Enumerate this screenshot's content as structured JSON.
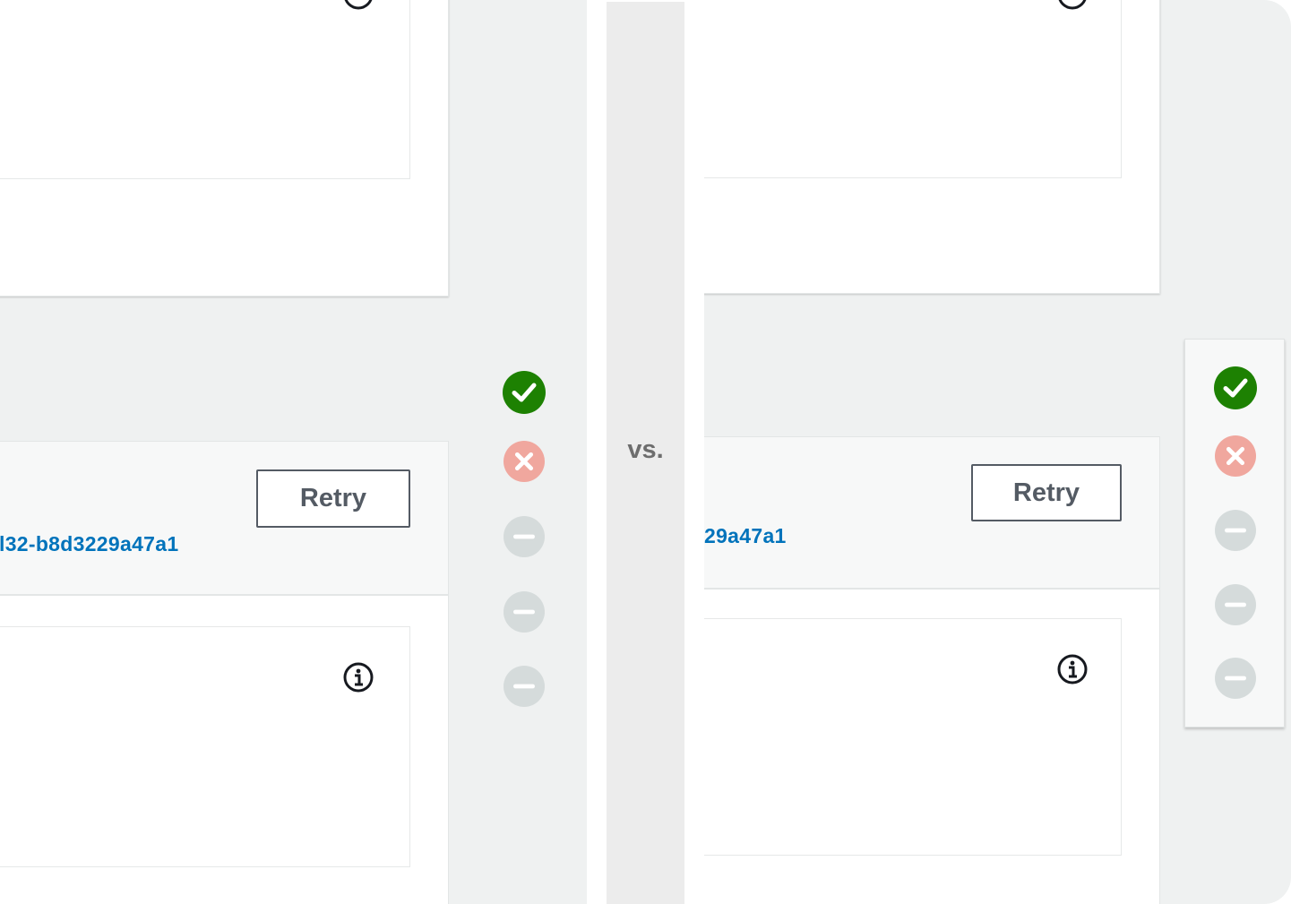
{
  "left": {
    "retry_label": "Retry",
    "execution_link": "l32-b8d3229a47a1",
    "status_icons": [
      "success-icon",
      "failed-icon",
      "pending-icon",
      "pending-icon",
      "pending-icon"
    ]
  },
  "divider": {
    "vs_label": "vs."
  },
  "right": {
    "retry_label": "Retry",
    "execution_link": "29a47a1",
    "status_icons": [
      "success-icon",
      "failed-icon",
      "pending-icon",
      "pending-icon",
      "pending-icon"
    ]
  },
  "colors": {
    "success": "#1d8102",
    "failed": "#f0a79e",
    "pending": "#d5dbdb",
    "link": "#0073bb",
    "background": "#eff1f1"
  }
}
